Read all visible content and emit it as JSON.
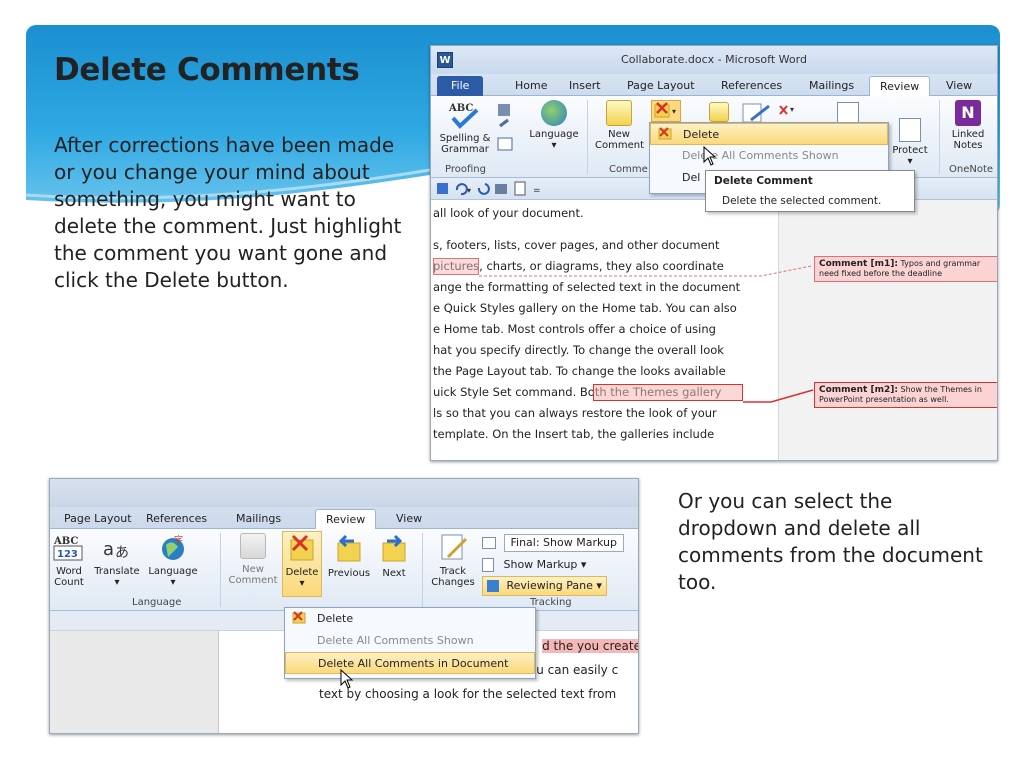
{
  "slide": {
    "title": "Delete Comments",
    "paragraph1": "After corrections have been made or you change your mind about something, you might want to delete the comment. Just highlight the comment you want gone and click the Delete button.",
    "paragraph2": "Or you can select the dropdown and delete all comments from the document too."
  },
  "shot1": {
    "window_title": "Collaborate.docx - Microsoft Word",
    "app_icon": "W",
    "tabs": [
      "File",
      "Home",
      "Insert",
      "Page Layout",
      "References",
      "Mailings",
      "Review",
      "View"
    ],
    "ribbon": {
      "spelling": "Spelling &",
      "grammar": "Grammar",
      "language": "Language",
      "new": "New",
      "comment": "Comment",
      "protect": "Protect",
      "linked": "Linked",
      "notes": "Notes",
      "group_proofing": "Proofing",
      "group_comments": "Comme",
      "group_onenote": "OneNote"
    },
    "dropdown": {
      "delete": "Delete",
      "delete_all_shown": "Delete All Comments Shown",
      "delete_all_shown_partial": "Del",
      "del_partial": "Del"
    },
    "tooltip": {
      "title": "Delete Comment",
      "desc": "Delete the selected comment."
    },
    "doc_lines": [
      "all look of your document.",
      "",
      "s, footers, lists, cover pages, and other document",
      "pictures, charts, or diagrams, they also coordinate",
      "ange the formatting of selected text in the document",
      "e Quick Styles gallery on the Home tab. You can also",
      "e Home tab. Most controls offer a choice of using",
      "hat you specify directly. To change the overall look",
      "the Page Layout tab. To change the looks available",
      "uick Style Set command. Both the Themes gallery",
      "ls so that you can always restore the look of your",
      "template. On the Insert tab, the galleries include"
    ],
    "comment1": {
      "label": "Comment [m1]:",
      "text": "Typos and grammar need fixed before the deadline"
    },
    "comment2": {
      "label": "Comment [m2]:",
      "text": "Show the Themes in PowerPoint presentation as well."
    }
  },
  "shot2": {
    "tabs": [
      "Page Layout",
      "References",
      "Mailings",
      "Review",
      "View"
    ],
    "ribbon": {
      "word_count": "Word Count",
      "word": "Word",
      "count": "Count",
      "translate": "Translate",
      "language": "Language",
      "new": "New",
      "comment": "Comment",
      "delete": "Delete",
      "previous": "Previous",
      "next": "Next",
      "track": "Track",
      "changes": "Changes",
      "final_show_markup": "Final: Show Markup",
      "show_markup": "Show Markup",
      "reviewing_pane": "Reviewing Pane",
      "group_language": "Language",
      "group_tracking": "Tracking"
    },
    "dropdown": {
      "delete": "Delete",
      "delete_all_shown": "Delete All Comments Shown",
      "delete_all_doc": "Delete All Comments in Document"
    },
    "doc_lines": [
      "d the you create",
      "with your current document look. You can easily c",
      "text by choosing a look for the selected text from"
    ]
  }
}
